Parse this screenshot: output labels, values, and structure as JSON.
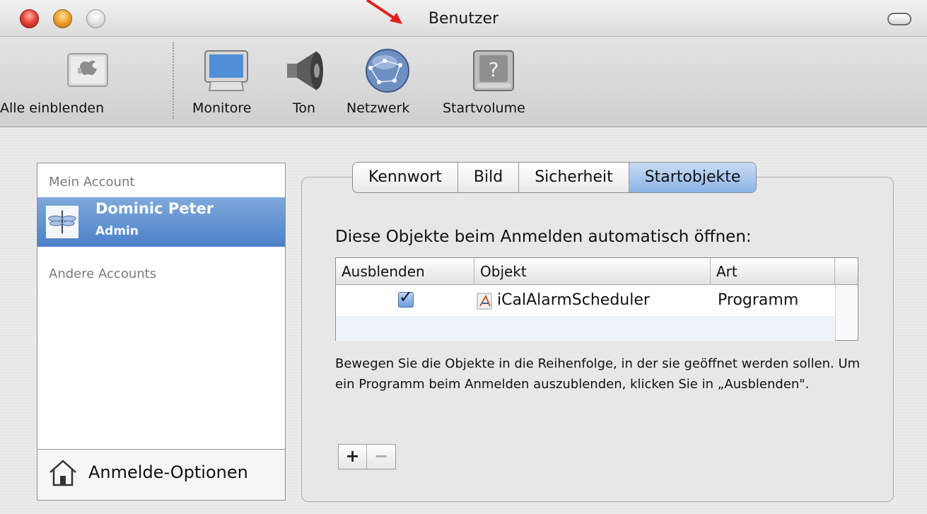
{
  "window": {
    "title": "Benutzer"
  },
  "toolbar": {
    "items": [
      {
        "label": "Alle einblenden",
        "icon": "show-all-icon"
      },
      {
        "label": "Monitore",
        "icon": "display-icon"
      },
      {
        "label": "Ton",
        "icon": "speaker-icon"
      },
      {
        "label": "Netzwerk",
        "icon": "network-globe-icon"
      },
      {
        "label": "Startvolume",
        "icon": "startup-disk-icon"
      }
    ]
  },
  "sidebar": {
    "my_account_header": "Mein Account",
    "selected_user": {
      "name": "Dominic Peter",
      "role": "Admin",
      "icon": "dragonfly-avatar-icon"
    },
    "other_accounts_header": "Andere Accounts",
    "login_options_label": "Anmelde-Optionen"
  },
  "tabs": [
    {
      "label": "Kennwort",
      "active": false
    },
    {
      "label": "Bild",
      "active": false
    },
    {
      "label": "Sicherheit",
      "active": false
    },
    {
      "label": "Startobjekte",
      "active": true
    }
  ],
  "startup_items": {
    "heading": "Diese Objekte beim Anmelden automatisch öffnen:",
    "columns": [
      "Ausblenden",
      "Objekt",
      "Art"
    ],
    "rows": [
      {
        "hide": true,
        "object": "iCalAlarmScheduler",
        "kind": "Programm",
        "icon": "application-icon"
      }
    ],
    "description": "Bewegen Sie die Objekte in die Reihenfolge, in der sie geöffnet werden sollen. Um ein Programm beim Anmelden auszublenden, klicken Sie in „Ausblenden\".",
    "add_label": "+",
    "remove_label": "−"
  },
  "colors": {
    "selection_blue": "#4a7fc8",
    "active_tab": "#8cb3e8",
    "annotation_arrow": "#e0201c"
  }
}
